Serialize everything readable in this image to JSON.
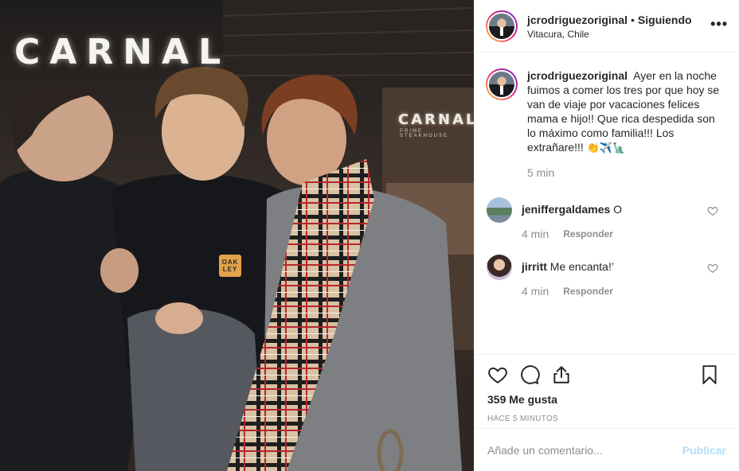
{
  "post": {
    "author": "jcrodriguezoriginal",
    "separator": "•",
    "follow_status": "Siguiendo",
    "location": "Vitacura, Chile",
    "more_icon": "more-options-icon"
  },
  "photo": {
    "sign_text": "CARNAL",
    "sign_small": "CARNAL",
    "sign_small_sub": "PRIME · STEAKHOUSE",
    "hoodie_logo": "OAK LEY"
  },
  "caption": {
    "username": "jcrodriguezoriginal",
    "text": "Ayer en la noche fuimos a comer los tres por que hoy se van de viaje por vacaciones felices mama e hijo!! Que rica despedida son lo máximo como familia!!! Los extrañare!!!",
    "emojis": "👏✈️🗽",
    "time": "5 min"
  },
  "comments": [
    {
      "username": "jeniffergaldames",
      "text": "O",
      "time": "4 min",
      "reply": "Responder"
    },
    {
      "username": "jirritt",
      "text": "Me encanta!’",
      "time": "4 min",
      "reply": "Responder"
    }
  ],
  "actions": {
    "likes": "359 Me gusta",
    "posted": "HACE 5 MINUTOS"
  },
  "add_comment": {
    "placeholder": "Añade un comentario...",
    "publish": "Publicar"
  },
  "colors": {
    "border": "#efefef",
    "muted": "#8e8e8e",
    "text": "#262626",
    "publish_disabled": "#b2dffc"
  }
}
